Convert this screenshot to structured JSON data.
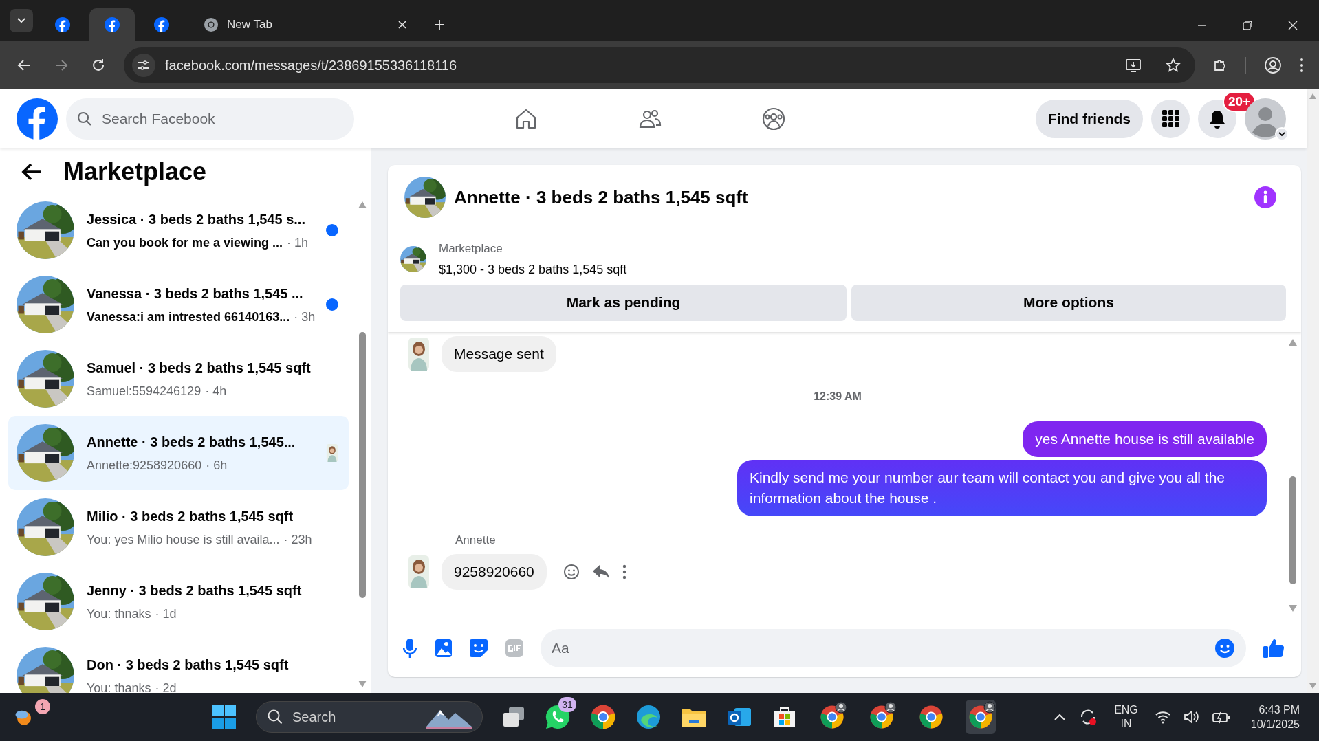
{
  "browser": {
    "tabs": [
      {
        "kind": "facebook",
        "selected": false
      },
      {
        "kind": "facebook",
        "selected": true
      },
      {
        "kind": "facebook",
        "selected": false
      },
      {
        "kind": "chrome",
        "title": "New Tab",
        "selected": false
      }
    ],
    "url": "facebook.com/messages/t/23869155336118116"
  },
  "header": {
    "search_placeholder": "Search Facebook",
    "find_friends": "Find friends",
    "notification_badge": "20+"
  },
  "sidebar": {
    "title": "Marketplace",
    "conversations": [
      {
        "title": "Jessica · 3 beds 2 baths 1,545 s...",
        "preview": "Can you book for me a viewing ...",
        "time": "· 1h",
        "unread": true,
        "seen": false,
        "selected": false
      },
      {
        "title": "Vanessa · 3 beds 2 baths 1,545 ...",
        "preview": "Vanessa:i am intrested 66140163...",
        "time": "· 3h",
        "unread": true,
        "seen": false,
        "selected": false
      },
      {
        "title": "Samuel · 3 beds 2 baths 1,545 sqft",
        "preview": "Samuel:5594246129",
        "time": "· 4h",
        "unread": false,
        "seen": false,
        "selected": false
      },
      {
        "title": "Annette · 3 beds 2 baths 1,545...",
        "preview": "Annette:9258920660",
        "time": "· 6h",
        "unread": false,
        "seen": true,
        "selected": true
      },
      {
        "title": "Milio · 3 beds 2 baths 1,545 sqft",
        "preview": "You: yes Milio house is still availa...",
        "time": "· 23h",
        "unread": false,
        "seen": false,
        "selected": false
      },
      {
        "title": "Jenny · 3 beds 2 baths 1,545 sqft",
        "preview": "You: thnaks",
        "time": "· 1d",
        "unread": false,
        "seen": false,
        "selected": false
      },
      {
        "title": "Don · 3 beds 2 baths 1,545 sqft",
        "preview": "You: thanks",
        "time": "· 2d",
        "unread": false,
        "seen": false,
        "selected": false
      }
    ]
  },
  "chat": {
    "title": "Annette · 3 beds 2 baths 1,545 sqft",
    "listing": {
      "label": "Marketplace",
      "price_line": "$1,300 - 3 beds 2 baths 1,545 sqft"
    },
    "buttons": [
      "Mark as pending",
      "More options"
    ],
    "messages": [
      {
        "kind": "received",
        "text": "Message sent"
      },
      {
        "kind": "timestamp",
        "text": "12:39 AM"
      },
      {
        "kind": "sent",
        "text": "yes Annette house is still available"
      },
      {
        "kind": "sent",
        "text": "Kindly send me your number aur team will contact you and give you all the information about the house ."
      },
      {
        "kind": "sender_name",
        "text": "Annette"
      },
      {
        "kind": "received",
        "text": "9258920660",
        "actions": true
      }
    ],
    "composer_placeholder": "Aa"
  },
  "taskbar": {
    "weather_badge": "1",
    "search_placeholder": "Search",
    "whatsapp_badge": "31",
    "language": "ENG",
    "region": "IN",
    "time": "6:43 PM",
    "date": "10/1/2025"
  }
}
